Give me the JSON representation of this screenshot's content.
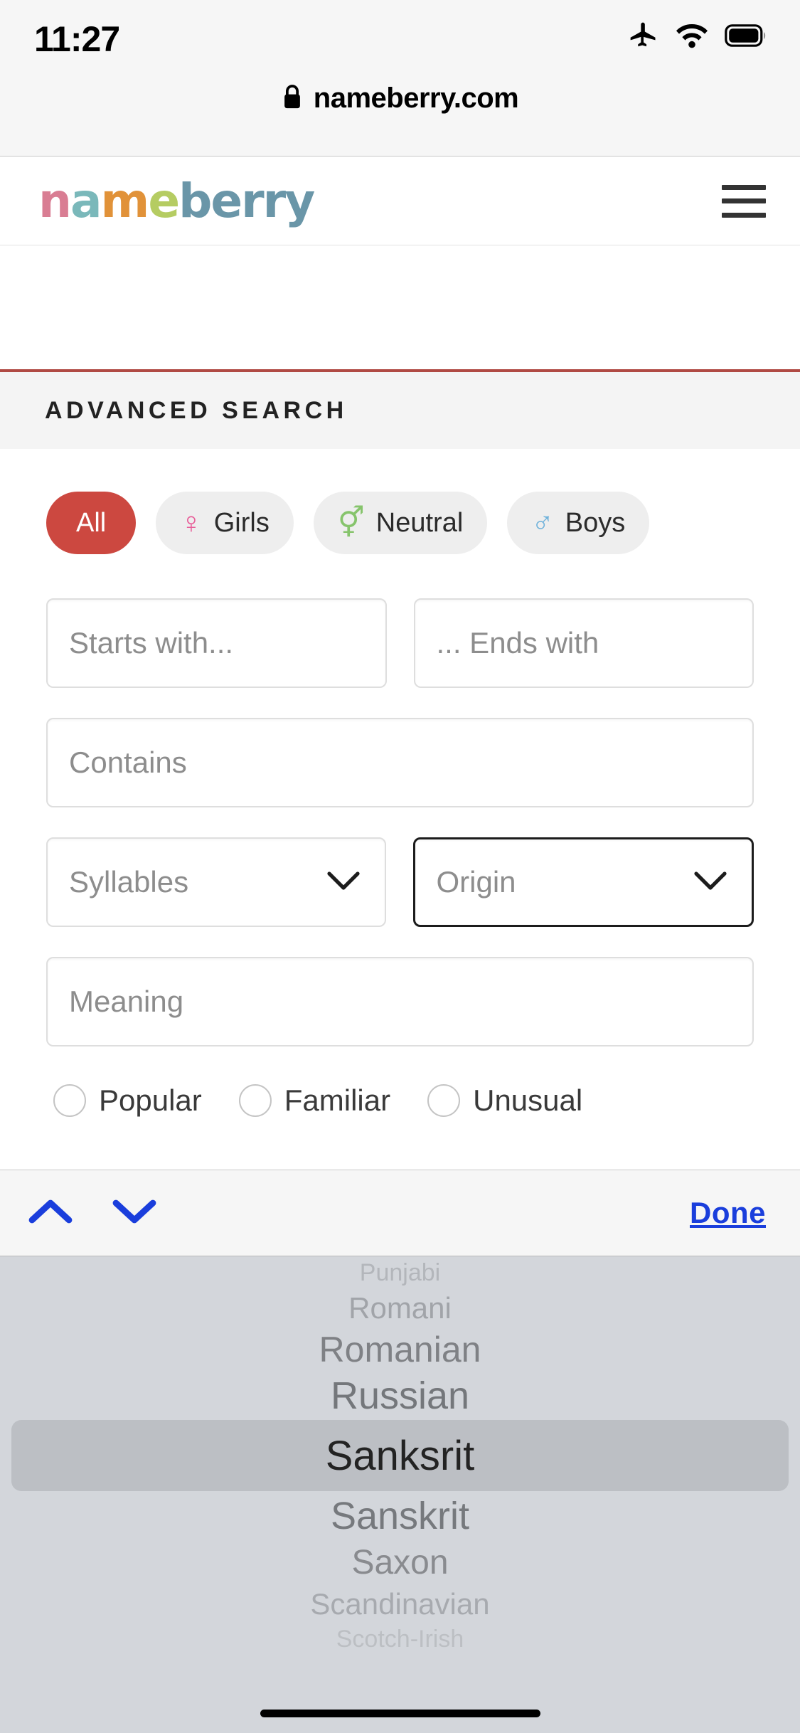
{
  "status_bar": {
    "time": "11:27",
    "icons": [
      "airplane-mode-icon",
      "wifi-icon",
      "battery-icon"
    ]
  },
  "browser": {
    "url": "nameberry.com",
    "lock_icon": "lock-icon"
  },
  "site_header": {
    "logo_text": "nameberry",
    "logo_letters": [
      {
        "char": "n",
        "color": "#d97d93"
      },
      {
        "char": "a",
        "color": "#7ab8ba"
      },
      {
        "char": "m",
        "color": "#e19239"
      },
      {
        "char": "e",
        "color": "#b5cc62"
      },
      {
        "char": "b",
        "color": "#6a96a8"
      },
      {
        "char": "e",
        "color": "#6a96a8"
      },
      {
        "char": "r",
        "color": "#6a96a8"
      },
      {
        "char": "r",
        "color": "#6a96a8"
      },
      {
        "char": "y",
        "color": "#6a96a8"
      }
    ],
    "menu_icon": "hamburger-menu-icon"
  },
  "section": {
    "title": "ADVANCED SEARCH",
    "accent_color": "#b04a44"
  },
  "gender_filters": [
    {
      "label": "All",
      "symbol": "",
      "selected": true,
      "symbol_class": ""
    },
    {
      "label": "Girls",
      "symbol": "♀",
      "selected": false,
      "symbol_class": "girls"
    },
    {
      "label": "Neutral",
      "symbol": "⚥",
      "selected": false,
      "symbol_class": "neutral"
    },
    {
      "label": "Boys",
      "symbol": "♂",
      "selected": false,
      "symbol_class": "boys"
    }
  ],
  "fields": {
    "starts_with": {
      "placeholder": "Starts with...",
      "value": ""
    },
    "ends_with": {
      "placeholder": "... Ends with",
      "value": ""
    },
    "contains": {
      "placeholder": "Contains",
      "value": ""
    },
    "syllables": {
      "placeholder": "Syllables",
      "value": ""
    },
    "origin": {
      "placeholder": "Origin",
      "value": "",
      "focused": true
    },
    "meaning": {
      "placeholder": "Meaning",
      "value": ""
    }
  },
  "style_radios": [
    {
      "label": "Popular"
    },
    {
      "label": "Familiar"
    },
    {
      "label": "Unusual"
    }
  ],
  "keyboard_accessory": {
    "prev_icon": "chevron-up-icon",
    "next_icon": "chevron-down-icon",
    "done_label": "Done",
    "accent_color": "#1a3edc"
  },
  "origin_picker": {
    "selected": "Sanksrit",
    "options": [
      "Punjabi",
      "Romani",
      "Romanian",
      "Russian",
      "Sanksrit",
      "Sanskrit",
      "Saxon",
      "Scandinavian",
      "Scotch-Irish"
    ],
    "selected_index": 4
  }
}
